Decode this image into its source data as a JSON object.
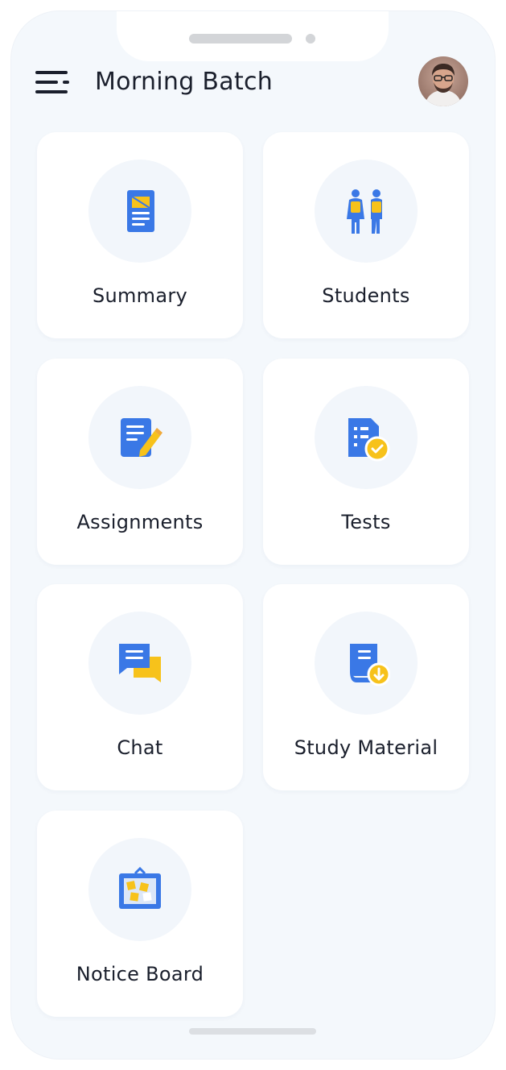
{
  "header": {
    "title": "Morning Batch",
    "menu_icon": "hamburger-menu-icon",
    "avatar_icon": "user-avatar"
  },
  "tiles": [
    {
      "label": "Summary",
      "icon": "summary-document-icon"
    },
    {
      "label": "Students",
      "icon": "students-icon"
    },
    {
      "label": "Assignments",
      "icon": "assignment-edit-icon"
    },
    {
      "label": "Tests",
      "icon": "test-check-icon"
    },
    {
      "label": "Chat",
      "icon": "chat-bubbles-icon"
    },
    {
      "label": "Study Material",
      "icon": "study-material-book-icon"
    },
    {
      "label": "Notice Board",
      "icon": "notice-board-icon"
    }
  ],
  "colors": {
    "primary_blue": "#3a78e6",
    "accent_yellow": "#f7c21b",
    "background": "#f4f8fc",
    "text": "#1a1f2c"
  }
}
